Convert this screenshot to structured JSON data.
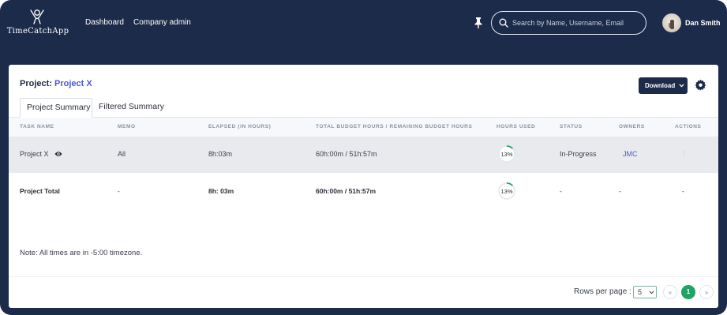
{
  "app": {
    "logo_text": "TimeCatchApp",
    "nav": {
      "dashboard": "Dashboard",
      "company_admin": "Company admin"
    },
    "search": {
      "placeholder": "Search by Name, Username, Email",
      "value": ""
    },
    "user": {
      "name": "Dan Smith"
    },
    "colors": {
      "navy": "#1c2b4a",
      "link": "#4a58d6",
      "accent_green": "#1fa463"
    }
  },
  "project": {
    "label": "Project:",
    "name": "Project X",
    "download_label": "Download",
    "tabs": [
      {
        "label": "Project Summary",
        "active": true
      },
      {
        "label": "Filtered Summary",
        "active": false
      }
    ]
  },
  "table": {
    "headers": {
      "task_name": "TASK NAME",
      "memo": "MEMO",
      "elapsed": "ELAPSED (IN HOURS)",
      "budget": "TOTAL BUDGET HOURS / REMAINING BUDGET HOURS",
      "hours_used": "HOURS USED",
      "status": "STATUS",
      "owners": "OWNERS",
      "actions": "ACTIONS"
    },
    "rows": [
      {
        "task_name": "Project X",
        "memo": "All",
        "elapsed": "8h:03m",
        "budget": "60h:00m / 51h:57m",
        "hours_used_label": "13%",
        "hours_used_fraction": 0.13,
        "status": "In-Progress",
        "owners": "JMC",
        "actions": "⋮"
      }
    ],
    "total": {
      "task_name": "Project Total",
      "memo": "-",
      "elapsed": "8h: 03m",
      "budget": "60h:00m / 51h:57m",
      "hours_used_label": "13%",
      "hours_used_fraction": 0.13,
      "status": "-",
      "owners": "-",
      "actions": "-"
    }
  },
  "note": "Note: All times are in -5:00 timezone.",
  "pagination": {
    "rows_per_page_label": "Rows per page :",
    "rows_per_page": "5",
    "prev": "«",
    "current": "1",
    "next": "»"
  }
}
